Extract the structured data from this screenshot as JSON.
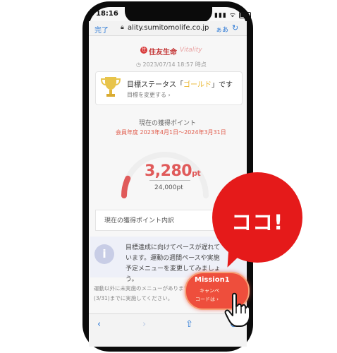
{
  "status_bar": {
    "time": "18:16",
    "icons": "▮▮▮ ᯤ"
  },
  "browser": {
    "done_label": "完了",
    "lock_icon": "lock-icon",
    "url": "ality.sumitomolife.co.jp",
    "reader_label": "ぁあ",
    "reload_icon": "↻"
  },
  "logo": {
    "mark": "住",
    "text": "住友生命",
    "sub": "Vitality"
  },
  "timestamp": "◷ 2023/07/14 18:57 時点",
  "status_card": {
    "prefix": "目標ステータス「",
    "goal": "ゴールド",
    "suffix": "」です",
    "link": "目標を変更する ›"
  },
  "points": {
    "heading": "現在の獲得ポイント",
    "period": "会員年度 2023年4月1日～2024年3月31日",
    "value": "3,280",
    "unit": "pt",
    "target": "24,000pt",
    "progress_fraction": 0.137
  },
  "breakdown": {
    "label": "現在の獲得ポイント内訳"
  },
  "info": {
    "icon": "i",
    "text": "目標達成に向けてペースが遅れています。運動の週間ペースや実施予定メニューを変更してみましょう。"
  },
  "note": {
    "text": "運動以外に未実施のメニューがあります(3/31)までに実施してください。"
  },
  "nav": {
    "back": "‹",
    "forward": "›",
    "share": "⇧",
    "tabs": "⊙"
  },
  "callout": {
    "text": "ココ!"
  },
  "mission_button": {
    "title": "Mission1",
    "line2": "キャンペ",
    "line3": "コードは ›"
  },
  "colors": {
    "accent_red": "#e51a1a",
    "mission_red": "#ee4e3c",
    "link_blue": "#2f7bd6",
    "gauge_red": "#e05a5a",
    "gold": "#e9b52a"
  }
}
